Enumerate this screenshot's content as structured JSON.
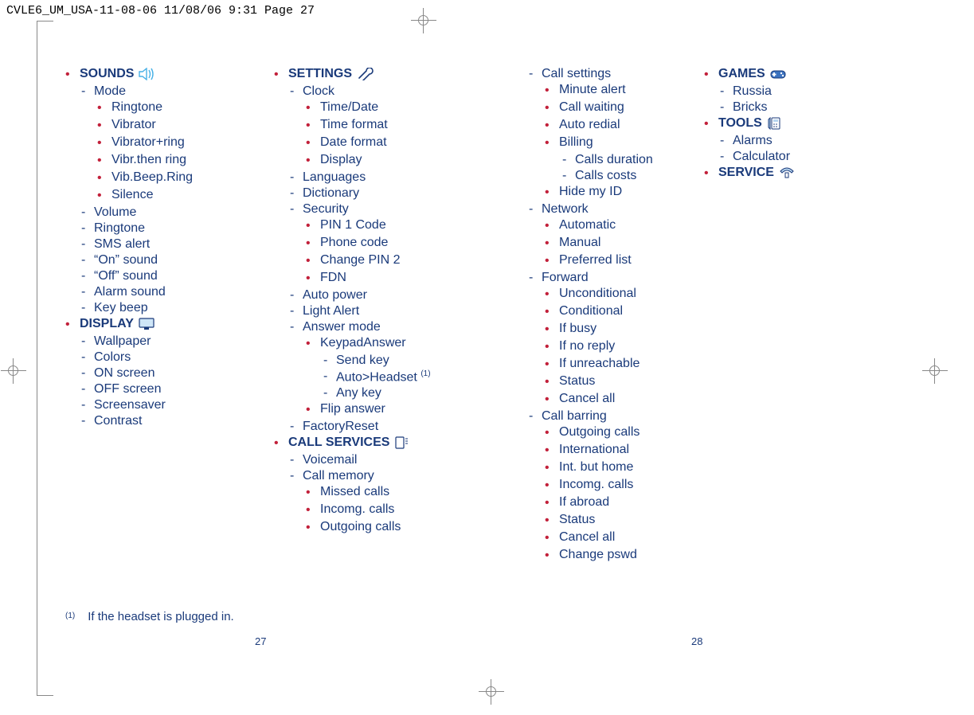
{
  "header": "CVLE6_UM_USA-11-08-06  11/08/06  9:31  Page 27",
  "page_left": "27",
  "page_right": "28",
  "footnote": {
    "mark": "(1)",
    "text": "If the headset is plugged in."
  },
  "col1": {
    "sounds": {
      "title": "SOUNDS",
      "mode": "Mode",
      "mode_items": [
        "Ringtone",
        "Vibrator",
        "Vibrator+ring",
        "Vibr.then ring",
        "Vib.Beep.Ring",
        "Silence"
      ],
      "rest": [
        "Volume",
        "Ringtone",
        "SMS alert",
        "“On” sound",
        "“Off” sound",
        "Alarm sound",
        "Key beep"
      ]
    },
    "display": {
      "title": "DISPLAY",
      "items": [
        "Wallpaper",
        "Colors",
        "ON screen",
        "OFF screen",
        "Screensaver",
        "Contrast"
      ]
    }
  },
  "col2": {
    "settings": {
      "title": "SETTINGS",
      "clock": "Clock",
      "clock_items": [
        "Time/Date",
        "Time format",
        "Date format",
        "Display"
      ],
      "languages": "Languages",
      "dictionary": "Dictionary",
      "security": "Security",
      "security_items": [
        "PIN 1 Code",
        "Phone code",
        "Change PIN 2",
        "FDN"
      ],
      "autopower": "Auto power",
      "lightalert": "Light Alert",
      "answermode": "Answer mode",
      "keypad": "KeypadAnswer",
      "keypad_items": [
        "Send key",
        "Auto>Headset",
        "Any key"
      ],
      "flip": "Flip answer",
      "factory": "FactoryReset"
    },
    "callsvc": {
      "title": "CALL SERVICES",
      "voicemail": "Voicemail",
      "callmem": "Call memory",
      "callmem_items": [
        "Missed calls",
        "Incomg. calls",
        "Outgoing calls"
      ]
    }
  },
  "col3": {
    "callsettings": {
      "title": "Call settings",
      "items": [
        "Minute alert",
        "Call waiting",
        "Auto redial"
      ],
      "billing": "Billing",
      "billing_items": [
        "Calls duration",
        "Calls costs"
      ],
      "hide": "Hide my ID"
    },
    "network": {
      "title": "Network",
      "items": [
        "Automatic",
        "Manual",
        "Preferred list"
      ]
    },
    "forward": {
      "title": "Forward",
      "items": [
        "Unconditional",
        "Conditional",
        "If busy",
        "If no reply",
        "If unreachable",
        "Status",
        "Cancel all"
      ]
    },
    "barring": {
      "title": "Call barring",
      "items": [
        "Outgoing calls",
        "International",
        "Int. but home",
        "Incomg. calls",
        "If abroad",
        "Status",
        "Cancel all",
        "Change pswd"
      ]
    }
  },
  "col4": {
    "games": {
      "title": "GAMES",
      "items": [
        "Russia",
        "Bricks"
      ]
    },
    "tools": {
      "title": "TOOLS",
      "items": [
        "Alarms",
        "Calculator"
      ]
    },
    "service": {
      "title": "SERVICE"
    }
  },
  "sup": "(1)"
}
